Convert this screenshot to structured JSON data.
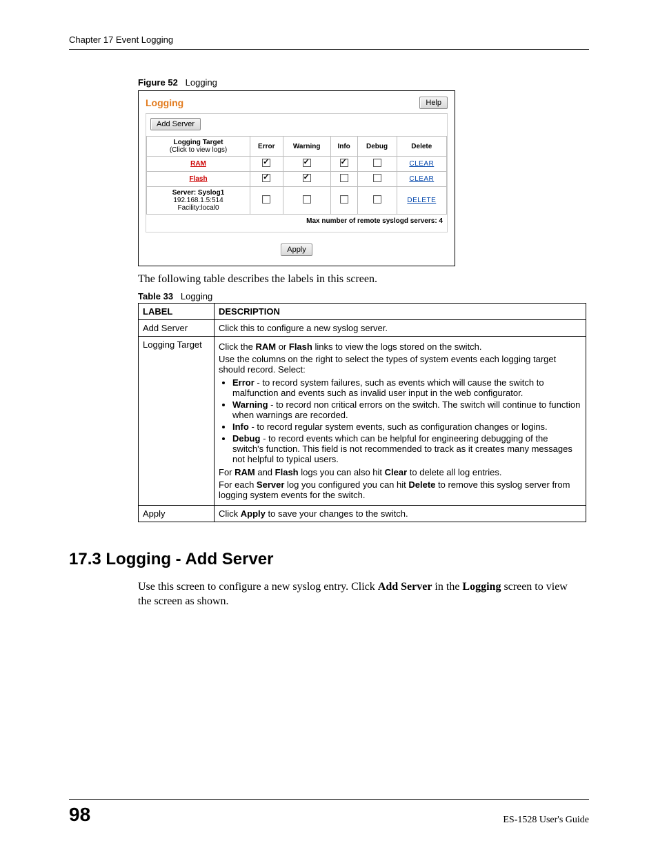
{
  "header": {
    "title": "Chapter 17 Event Logging"
  },
  "figure": {
    "label": "Figure 52",
    "name": "Logging"
  },
  "screenshot": {
    "title": "Logging",
    "helpLabel": "Help",
    "addServerLabel": "Add Server",
    "columns": {
      "target": "Logging Target",
      "targetSub": "(Click to view logs)",
      "error": "Error",
      "warning": "Warning",
      "info": "Info",
      "debug": "Debug",
      "delete": "Delete"
    },
    "rows": {
      "ram": {
        "label": "RAM",
        "action": "CLEAR"
      },
      "flash": {
        "label": "Flash",
        "action": "CLEAR"
      },
      "server": {
        "line1": "Server: Syslog1",
        "line2": "192.168.1.5:514",
        "line3": "Facility:local0",
        "action": "DELETE"
      }
    },
    "maxNote": "Max number of remote syslogd servers: 4",
    "applyLabel": "Apply"
  },
  "afterFigure": "The following table describes the labels in this screen.",
  "table": {
    "label": "Table 33",
    "name": "Logging",
    "headers": {
      "label": "LABEL",
      "description": "DESCRIPTION"
    },
    "rows": {
      "addServer": {
        "label": "Add Server",
        "desc": "Click this to configure a new syslog server."
      },
      "loggingTarget": {
        "label": "Logging Target",
        "p1a": "Click the ",
        "p1b": "RAM",
        "p1c": " or ",
        "p1d": "Flash",
        "p1e": " links to view the logs stored on the switch.",
        "p2": "Use the columns on the right to select the types of system events each logging target should record. Select:",
        "li1a": "Error",
        "li1b": " - to record system failures, such as events which will cause the switch to malfunction and events such as invalid user input in the web configurator.",
        "li2a": "Warning",
        "li2b": " - to record non critical errors on the switch. The switch will continue to function when warnings are recorded.",
        "li3a": "Info",
        "li3b": " - to record regular system events, such as configuration changes or logins.",
        "li4a": "Debug",
        "li4b": " - to record events which can be helpful for engineering debugging of the switch's function. This field is not recommended to track as it creates many messages not helpful to typical users.",
        "p3a": "For ",
        "p3b": "RAM",
        "p3c": " and ",
        "p3d": "Flash",
        "p3e": " logs you can also hit ",
        "p3f": "Clear",
        "p3g": " to delete all log entries.",
        "p4a": "For each ",
        "p4b": "Server",
        "p4c": " log you configured you can hit ",
        "p4d": "Delete",
        "p4e": " to remove this syslog server from logging system events for the switch."
      },
      "apply": {
        "label": "Apply",
        "d1": "Click ",
        "d2": "Apply",
        "d3": " to save your changes to the switch."
      }
    }
  },
  "section": {
    "heading": "17.3  Logging - Add Server",
    "b1": "Use this screen to configure a new syslog entry. Click ",
    "b2": "Add Server",
    "b3": " in the ",
    "b4": "Logging",
    "b5": " screen to view the screen as shown."
  },
  "footer": {
    "page": "98",
    "guide": "ES-1528 User's Guide"
  }
}
